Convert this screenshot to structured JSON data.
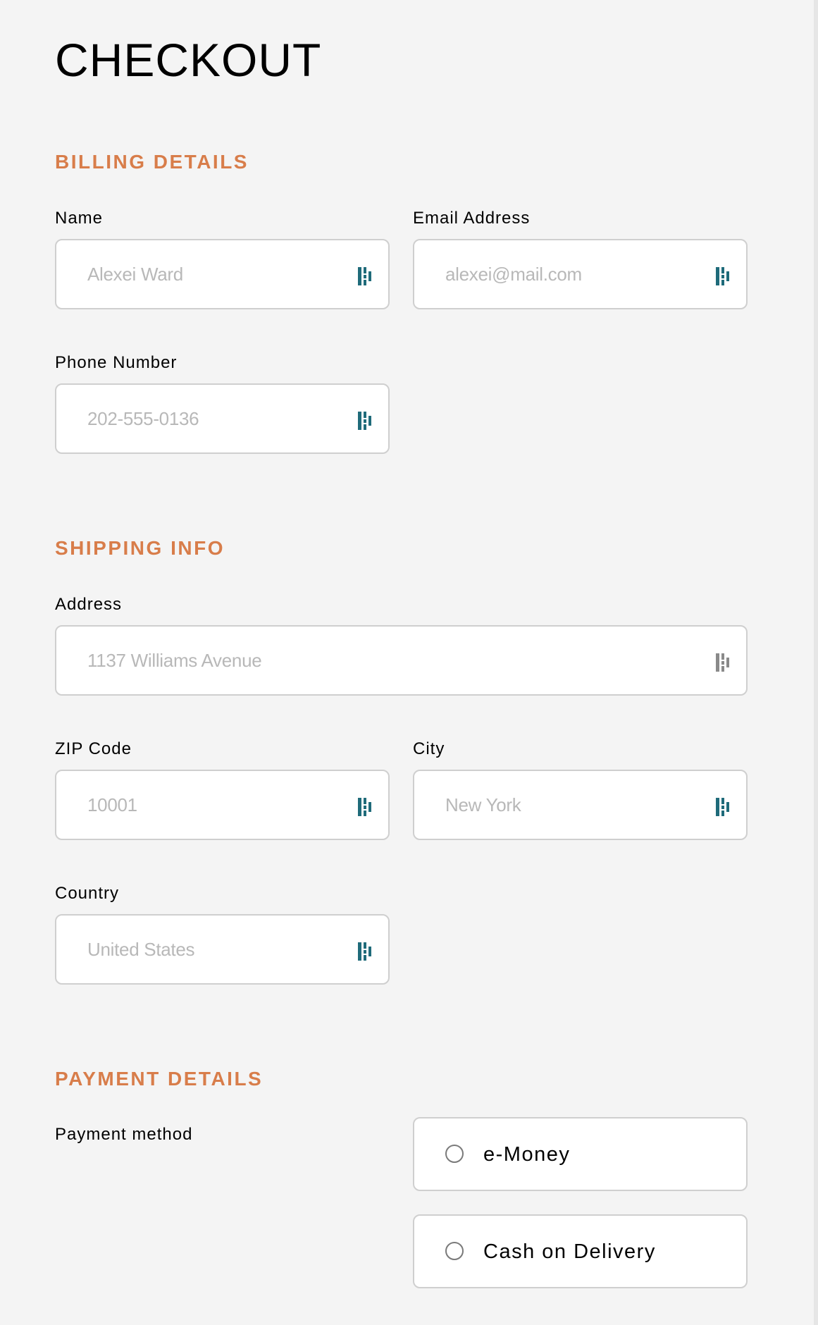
{
  "page": {
    "title": "CHECKOUT"
  },
  "billing": {
    "section_title": "BILLING DETAILS",
    "name": {
      "label": "Name",
      "placeholder": "Alexei Ward"
    },
    "email": {
      "label": "Email Address",
      "placeholder": "alexei@mail.com"
    },
    "phone": {
      "label": "Phone Number",
      "placeholder": "202-555-0136"
    }
  },
  "shipping": {
    "section_title": "SHIPPING INFO",
    "address": {
      "label": "Address",
      "placeholder": "1137 Williams Avenue"
    },
    "zip": {
      "label": "ZIP Code",
      "placeholder": "10001"
    },
    "city": {
      "label": "City",
      "placeholder": "New York"
    },
    "country": {
      "label": "Country",
      "placeholder": "United States"
    }
  },
  "payment": {
    "section_title": "PAYMENT DETAILS",
    "method_label": "Payment method",
    "options": [
      {
        "label": "e-Money",
        "selected": false
      },
      {
        "label": "Cash on Delivery",
        "selected": false
      }
    ]
  },
  "icons": {
    "autofill": "password-manager-icon",
    "radio": "radio-circle-icon"
  },
  "colors": {
    "accent": "#d87d4a",
    "icon_teal": "#1f6b7a",
    "icon_gray": "#8a8a8a",
    "border": "#cfcfcf",
    "placeholder": "#b8b8b8",
    "background": "#f4f4f4"
  }
}
